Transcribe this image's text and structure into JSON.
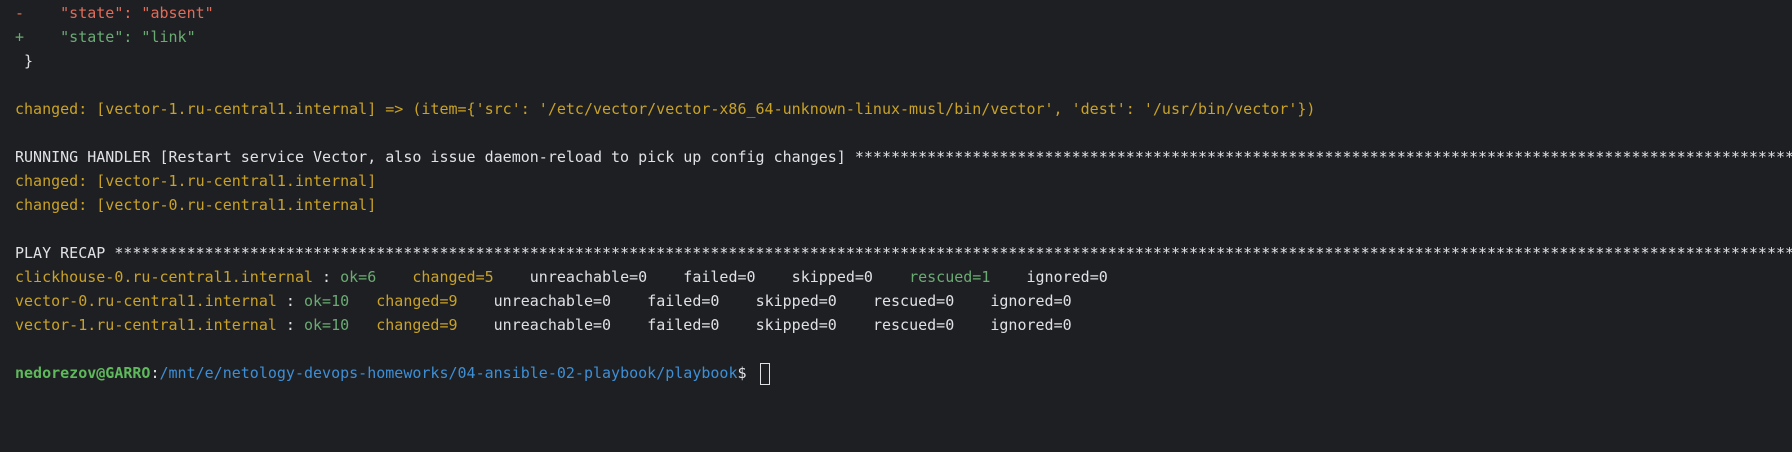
{
  "diff": {
    "removed_prefix": "-",
    "removed_text": "    \"state\": \"absent\"",
    "added_prefix": "+",
    "added_text": "    \"state\": \"link\"",
    "closing_brace": " }"
  },
  "task_result": {
    "text": "changed: [vector-1.ru-central1.internal] => (item={'src': '/etc/vector/vector-x86_64-unknown-linux-musl/bin/vector', 'dest': '/usr/bin/vector'})"
  },
  "handler": {
    "header": "RUNNING HANDLER [Restart service Vector, also issue daemon-reload to pick up config changes] ************************************************************************************************************************************",
    "results": [
      "changed: [vector-1.ru-central1.internal]",
      "changed: [vector-0.ru-central1.internal]"
    ]
  },
  "recap": {
    "header": "PLAY RECAP ************************************************************************************************************************************************************************************************************************************",
    "hosts": [
      {
        "host": "clickhouse-0.ru-central1.internal",
        "sep": " : ",
        "ok": "ok=6",
        "gap_ok": "    ",
        "changed": "changed=5",
        "gap_changed": "    ",
        "unreachable": "unreachable=0",
        "gap_unreachable": "    ",
        "failed": "failed=0",
        "gap_failed": "    ",
        "skipped": "skipped=0",
        "gap_skipped": "    ",
        "rescued": "rescued=1",
        "gap_rescued": "    ",
        "ignored": "ignored=0"
      },
      {
        "host": "vector-0.ru-central1.internal",
        "sep": " : ",
        "ok": "ok=10",
        "gap_ok": "   ",
        "changed": "changed=9",
        "gap_changed": "    ",
        "unreachable": "unreachable=0",
        "gap_unreachable": "    ",
        "failed": "failed=0",
        "gap_failed": "    ",
        "skipped": "skipped=0",
        "gap_skipped": "    ",
        "rescued": "rescued=0",
        "gap_rescued": "    ",
        "ignored": "ignored=0"
      },
      {
        "host": "vector-1.ru-central1.internal",
        "sep": " : ",
        "ok": "ok=10",
        "gap_ok": "   ",
        "changed": "changed=9",
        "gap_changed": "    ",
        "unreachable": "unreachable=0",
        "gap_unreachable": "    ",
        "failed": "failed=0",
        "gap_failed": "    ",
        "skipped": "skipped=0",
        "gap_skipped": "    ",
        "rescued": "rescued=0",
        "gap_rescued": "    ",
        "ignored": "ignored=0"
      }
    ]
  },
  "prompt": {
    "user_host": "nedorezov@GARRO",
    "colon": ":",
    "path": "/mnt/e/netology-devops-homeworks/04-ansible-02-playbook/playbook",
    "symbol": "$ "
  },
  "colors": {
    "background": "#1e1f22",
    "text": "#dfe1e5",
    "removed": "#e06c5a",
    "added": "#6aab73",
    "changed": "#c9a227",
    "prompt_user": "#5fb95c",
    "prompt_path": "#3d8fd6"
  }
}
